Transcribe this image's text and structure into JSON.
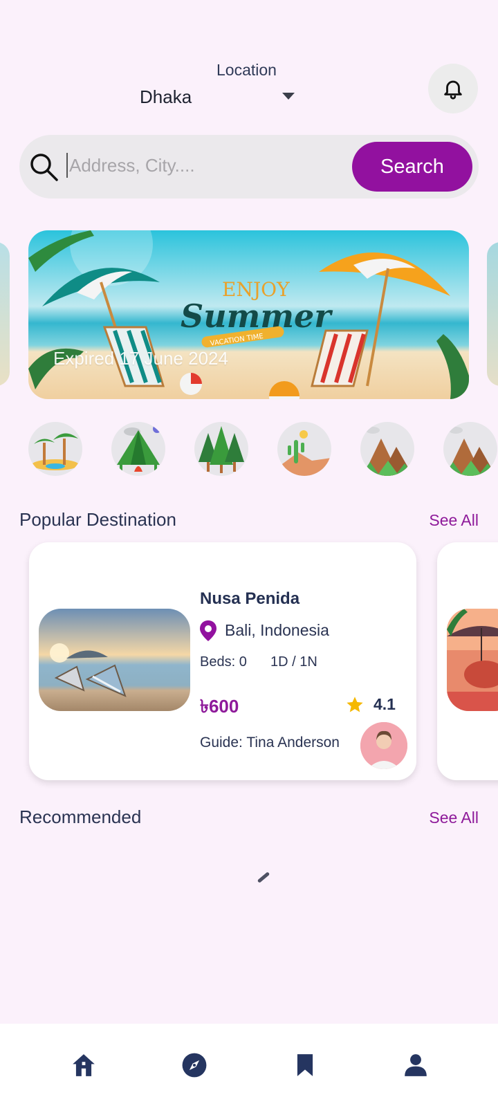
{
  "header": {
    "location_label": "Location",
    "location_value": "Dhaka"
  },
  "search": {
    "placeholder": "Address, City....",
    "button_label": "Search"
  },
  "banner": {
    "expiry_text": "Expired 17 June 2024",
    "artwork_text": [
      "ENJOY",
      "Summer",
      "VACATION TIME"
    ]
  },
  "categories": [
    "palm-beach-icon",
    "camping-tent-icon",
    "forest-icon",
    "desert-icon",
    "mountain-icon",
    "mountain-icon"
  ],
  "popular": {
    "title": "Popular Destination",
    "see_all": "See All",
    "items": [
      {
        "name": "Nusa Penida",
        "location": "Bali, Indonesia",
        "beds": "Beds: 0",
        "duration": "1D / 1N",
        "price": "৳600",
        "rating": "4.1",
        "guide": "Guide: Tina Anderson"
      }
    ]
  },
  "recommended": {
    "title": "Recommended",
    "see_all": "See All"
  },
  "nav": [
    "home-icon",
    "explore-icon",
    "bookmark-icon",
    "profile-icon"
  ],
  "colors": {
    "accent": "#92119f",
    "background": "#fbf1fb",
    "text_dark": "#2a3352",
    "star": "#f5b800"
  }
}
